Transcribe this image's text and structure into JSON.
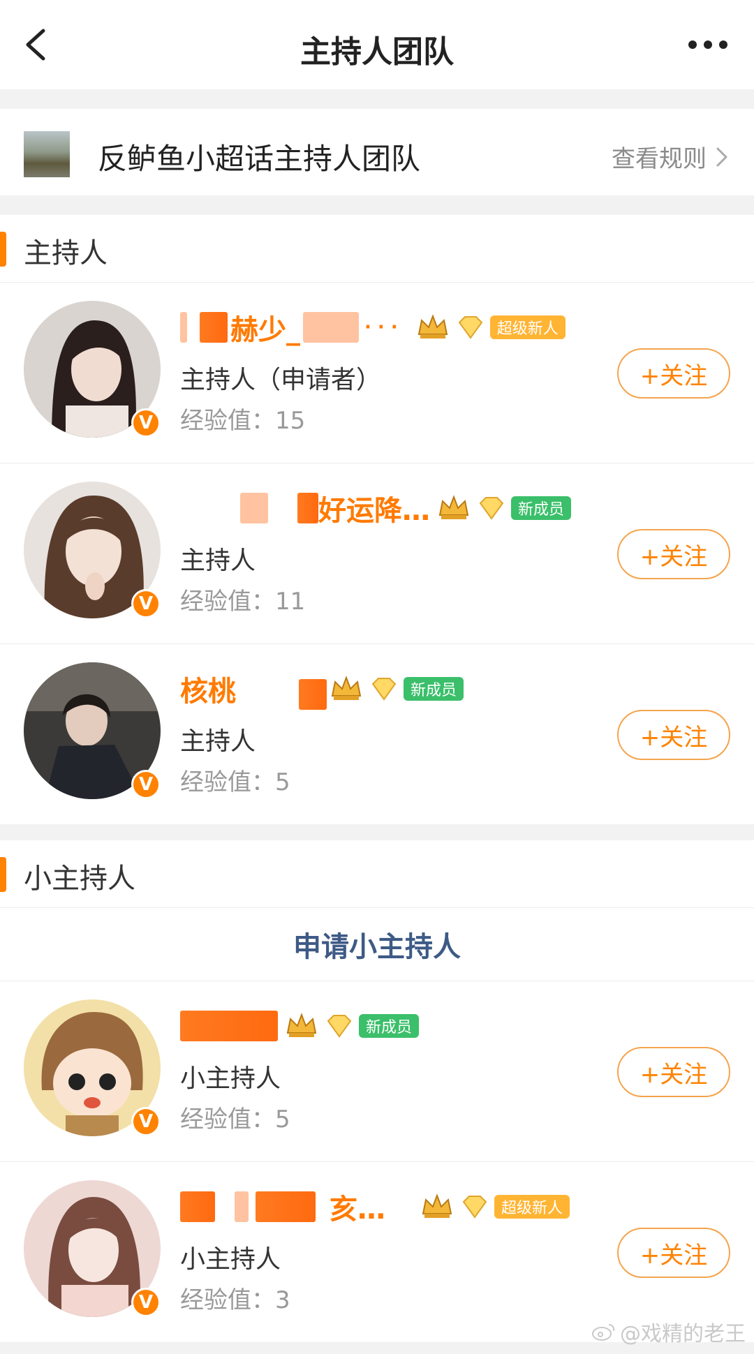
{
  "header": {
    "title": "主持人团队"
  },
  "topic": {
    "name": "反鲈鱼小超话主持人团队",
    "rules_label": "查看规则"
  },
  "sections": [
    {
      "title": "主持人",
      "members": [
        {
          "name": "赫少_",
          "role": "主持人（申请者）",
          "exp": "经验值：15",
          "badge": "超级新人",
          "badge_color": "#ffb433",
          "follow": "+关注"
        },
        {
          "name": "好运降…",
          "role": "主持人",
          "exp": "经验值：11",
          "badge": "新成员",
          "badge_color": "#3bbf6a",
          "follow": "+关注"
        },
        {
          "name": "核桃",
          "role": "主持人",
          "exp": "经验值：5",
          "badge": "新成员",
          "badge_color": "#3bbf6a",
          "follow": "+关注"
        }
      ]
    },
    {
      "title": "小主持人",
      "apply_label": "申请小主持人",
      "members": [
        {
          "name": "",
          "role": "小主持人",
          "exp": "经验值：5",
          "badge": "新成员",
          "badge_color": "#3bbf6a",
          "follow": "+关注"
        },
        {
          "name": "亥…",
          "role": "小主持人",
          "exp": "经验值：3",
          "badge": "超级新人",
          "badge_color": "#ffb433",
          "follow": "+关注"
        }
      ]
    }
  ],
  "verified_mark": "V",
  "watermark": "@戏精的老王",
  "colors": {
    "accent": "#ff8200",
    "link": "#3e5a86"
  }
}
